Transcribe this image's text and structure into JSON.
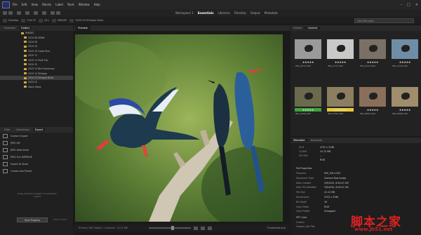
{
  "menubar": {
    "items": [
      "File",
      "Edit",
      "View",
      "Stacks",
      "Label",
      "Tools",
      "Window",
      "Help"
    ]
  },
  "workspaces": [
    "Workspace 1",
    "Essentials",
    "Libraries",
    "Filmstrip",
    "Output",
    "Metadata"
  ],
  "active_workspace": "Essentials",
  "search": {
    "placeholder": "Sort Manually"
  },
  "path": [
    "Desktop",
    "This PC",
    "(D:)",
    "IMAGES",
    "2020 02 Ethiopia Birds"
  ],
  "left_panel": {
    "tabs": [
      "Favorites",
      "Folders"
    ],
    "active_tab": "Folders",
    "folders": [
      "IMAGES",
      "2019 08 SPAIN",
      "2019 09",
      "2019 10",
      "2019 10 Costa Rica",
      "2019 11",
      "2019 11 Peak Trip",
      "2019 12",
      "2019 12 Bird Sanctuary",
      "2019 12 Ethiopia",
      "2020 02 Ethiopia Birds",
      "2020 03",
      "Stock Ideas"
    ],
    "selected_folder": "2020 02 Ethiopia Birds"
  },
  "export_panel": {
    "tabs": [
      "Filter",
      "Collections",
      "Export"
    ],
    "active_tab": "Export",
    "items": [
      "Custom Export",
      "JPEG HD",
      "JPEG Web Small",
      "JPEG Full 4MP8K2K",
      "Export to Stock",
      "Create new Preset"
    ],
    "drop_hint": "Drag and Drop images on a preset to export",
    "save_button": "Save Progress",
    "start_button": "Start Export"
  },
  "preview": {
    "tab": "Preview",
    "status": "79 items, 861 hidden, 1 selected · 24.12 MB",
    "view_label": "Thumbnails only"
  },
  "content": {
    "tabs": [
      "Publish",
      "Content"
    ],
    "active_tab": "Content",
    "thumbs": [
      {
        "name": "IMG_9014.CR2",
        "rating": 5,
        "label": "",
        "bg": "#9a9a9a"
      },
      {
        "name": "IMG_9113.CR2",
        "rating": 5,
        "label": "",
        "bg": "#c9c9c7"
      },
      {
        "name": "IMG_9124.CR2",
        "rating": 5,
        "label": "",
        "bg": "#7a7066"
      },
      {
        "name": "IMG_9136.CR2",
        "rating": 5,
        "label": "",
        "bg": "#6e8ea8"
      },
      {
        "name": "IMG_9209.CR2",
        "rating": 5,
        "label": "#3fa33c",
        "bg": "#6b6a4c"
      },
      {
        "name": "IMG_8790.CR2",
        "rating": 5,
        "label": "#e8c93a",
        "bg": "#8c7e60"
      },
      {
        "name": "IMG_8855.CR2",
        "rating": 5,
        "label": "",
        "bg": "#8a6f5a"
      },
      {
        "name": "IMG_8986.CR2",
        "rating": 5,
        "label": "",
        "bg": "#9f8d6b"
      }
    ]
  },
  "metadata": {
    "tabs": [
      "Metadata",
      "Keywords"
    ],
    "active_tab": "Metadata",
    "quick": [
      [
        "f/2.8",
        "4752 x 3168"
      ],
      [
        "1/1000",
        "24.12 MB"
      ],
      [
        "ISO 400",
        "--"
      ],
      [
        "",
        "RGB"
      ]
    ],
    "rows": [
      [
        "Filename",
        "IMG_9014.CR2"
      ],
      [
        "Document Type",
        "Camera Raw image"
      ],
      [
        "Date Created",
        "2/9/2020, 8:49:47 AM"
      ],
      [
        "Date File Modified",
        "2/9/2020, 8:49:47 AM"
      ],
      [
        "File Size",
        "24.12 MB"
      ],
      [
        "Dimensions",
        "4752 x 3168"
      ],
      [
        "Bit Depth",
        "16"
      ],
      [
        "Color Mode",
        "RGB"
      ],
      [
        "Color Profile",
        "Untagged"
      ]
    ],
    "sections": [
      "File Properties",
      "IPTC Core"
    ],
    "creator_label": "Creator",
    "creator_job": "Creator: Job Title"
  },
  "watermark": {
    "text": "脚本之家",
    "url": "www.jb51.net"
  }
}
